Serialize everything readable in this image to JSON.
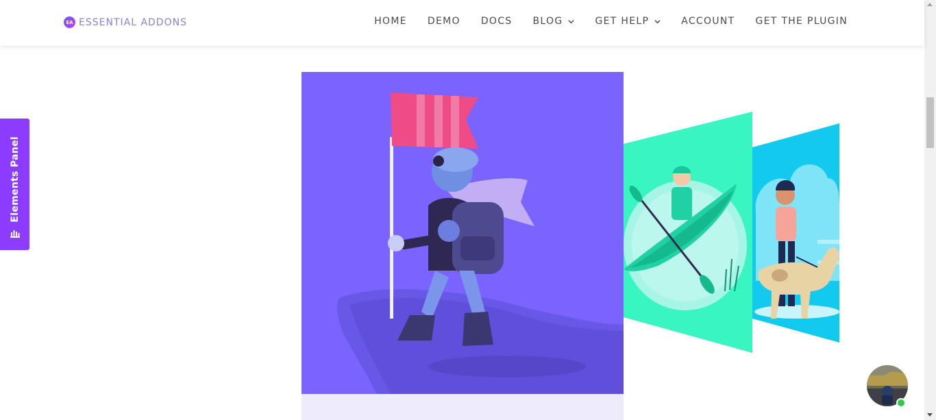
{
  "brand": {
    "logo_mark": "EA",
    "name": "ESSENTIAL ADDONS",
    "accent": "#8b3cff"
  },
  "nav": {
    "items": [
      {
        "label": "HOME",
        "has_dropdown": false
      },
      {
        "label": "DEMO",
        "has_dropdown": false
      },
      {
        "label": "DOCS",
        "has_dropdown": false
      },
      {
        "label": "BLOG",
        "has_dropdown": true
      },
      {
        "label": "GET HELP",
        "has_dropdown": true
      },
      {
        "label": "ACCOUNT",
        "has_dropdown": false
      },
      {
        "label": "GET THE PLUGIN",
        "has_dropdown": false
      }
    ]
  },
  "elements_panel": {
    "label": "Elements Panel",
    "icon": "bar-chart-icon",
    "color": "#8b3cff"
  },
  "hero": {
    "main_illustration": "hiker-with-flag-illustration",
    "main_bg": "#7a63ff",
    "secondary_illustrations": [
      "kayaker-illustration",
      "person-walking-dog-illustration"
    ]
  },
  "chat": {
    "avatar": "support-avatar",
    "status": "online",
    "status_color": "#2ec84a"
  }
}
